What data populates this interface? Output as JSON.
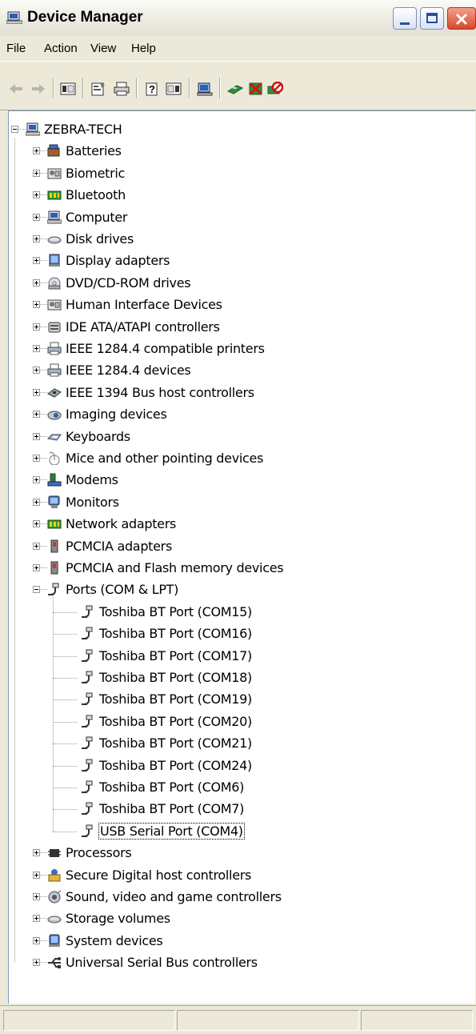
{
  "window": {
    "title": "Device Manager"
  },
  "menu": [
    "File",
    "Action",
    "View",
    "Help"
  ],
  "toolbar": {
    "icons": [
      "back-arrow-icon",
      "forward-arrow-icon",
      "show-hide-console-tree-icon",
      "properties-icon",
      "print-icon",
      "help-icon",
      "show-hide-action-pane-icon",
      "scan-hardware-changes-icon",
      "update-driver-icon",
      "uninstall-icon",
      "disable-icon"
    ]
  },
  "tree": {
    "root": "ZEBRA-TECH",
    "categories_before": [
      {
        "label": "Batteries",
        "icon": "battery-icon"
      },
      {
        "label": "Biometric",
        "icon": "biometric-icon"
      },
      {
        "label": "Bluetooth",
        "icon": "bluetooth-icon"
      },
      {
        "label": "Computer",
        "icon": "computer-icon"
      },
      {
        "label": "Disk drives",
        "icon": "disk-drive-icon"
      },
      {
        "label": "Display adapters",
        "icon": "display-adapter-icon"
      },
      {
        "label": "DVD/CD-ROM drives",
        "icon": "cdrom-icon"
      },
      {
        "label": "Human Interface Devices",
        "icon": "hid-icon"
      },
      {
        "label": "IDE ATA/ATAPI controllers",
        "icon": "ide-controller-icon"
      },
      {
        "label": "IEEE 1284.4 compatible printers",
        "icon": "printer-icon"
      },
      {
        "label": "IEEE 1284.4 devices",
        "icon": "printer-icon"
      },
      {
        "label": "IEEE 1394 Bus host controllers",
        "icon": "firewire-icon"
      },
      {
        "label": "Imaging devices",
        "icon": "camera-icon"
      },
      {
        "label": "Keyboards",
        "icon": "keyboard-icon"
      },
      {
        "label": "Mice and other pointing devices",
        "icon": "mouse-icon"
      },
      {
        "label": "Modems",
        "icon": "modem-icon"
      },
      {
        "label": "Monitors",
        "icon": "monitor-icon"
      },
      {
        "label": "Network adapters",
        "icon": "network-adapter-icon"
      },
      {
        "label": "PCMCIA adapters",
        "icon": "pcmcia-icon"
      },
      {
        "label": "PCMCIA and Flash memory devices",
        "icon": "pcmcia-icon"
      }
    ],
    "ports_category": {
      "label": "Ports (COM & LPT)",
      "icon": "port-icon"
    },
    "ports": [
      "Toshiba BT Port (COM15)",
      "Toshiba BT Port (COM16)",
      "Toshiba BT Port (COM17)",
      "Toshiba BT Port (COM18)",
      "Toshiba BT Port (COM19)",
      "Toshiba BT Port (COM20)",
      "Toshiba BT Port (COM21)",
      "Toshiba BT Port (COM24)",
      "Toshiba BT Port (COM6)",
      "Toshiba BT Port (COM7)",
      "USB Serial Port (COM4)"
    ],
    "selected_port": "USB Serial Port (COM4)",
    "categories_after": [
      {
        "label": "Processors",
        "icon": "processor-icon"
      },
      {
        "label": "Secure Digital host controllers",
        "icon": "sd-controller-icon"
      },
      {
        "label": "Sound, video and game controllers",
        "icon": "sound-icon"
      },
      {
        "label": "Storage volumes",
        "icon": "storage-volume-icon"
      },
      {
        "label": "System devices",
        "icon": "system-device-icon"
      },
      {
        "label": "Universal Serial Bus controllers",
        "icon": "usb-icon"
      }
    ]
  },
  "colors": {
    "title_gradient_top": "#fbfbf7",
    "close_button": "#d9472b",
    "chrome": "#ece9d8",
    "tree_bg": "#ffffff"
  }
}
